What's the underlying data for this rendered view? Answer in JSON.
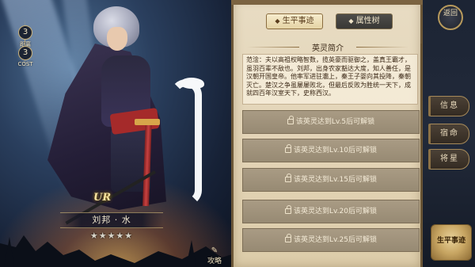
{
  "hero": {
    "rarity": "UR",
    "name": "刘邦 · 水",
    "stars": "★★★★★",
    "stats": [
      {
        "value": "3",
        "label": "距离"
      },
      {
        "value": "3",
        "label": "COST"
      }
    ]
  },
  "guide": {
    "icon": "✎",
    "label": "攻略"
  },
  "tabs": {
    "career": "生平事迹",
    "attributes": "属性树",
    "marker": "◆"
  },
  "section": {
    "title": "英灵简介"
  },
  "bio": "范淦：夫以高祖权略智数，揽英豪而驱御之，盖真王霸才，虽羽百辈不敌也。刘邦，出身农家豁达大度，知人善任，是汉朝开国皇帝。他率军进驻灞上，秦王子婴向其投降，秦朝灭亡。楚汉之争虽屡屡败北，但最后反败为胜统一天下，成就四百年汉室天下，史称西汉。",
  "locked_entries": [
    "该英灵达到Lv.5后可解锁",
    "该英灵达到Lv.10后可解锁",
    "该英灵达到Lv.15后可解锁",
    "该英灵达到Lv.20后可解锁",
    "该英灵达到Lv.25后可解锁"
  ],
  "side": {
    "back": "返回",
    "tabs": [
      "信息",
      "宿命",
      "将星"
    ],
    "career_button": "生平事迹"
  },
  "colors": {
    "parchment": "#e2d3b5",
    "gold_border": "#b89a5c",
    "locked_row": "#a99b84"
  }
}
